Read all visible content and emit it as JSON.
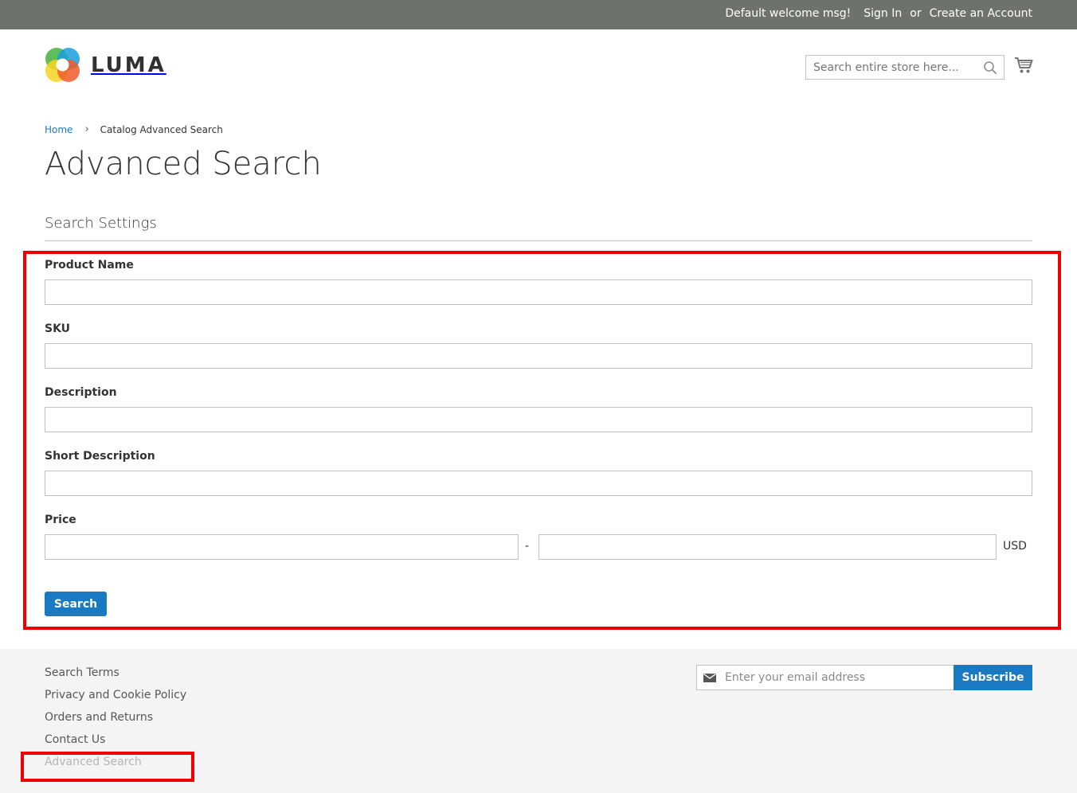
{
  "panel": {
    "welcome": "Default welcome msg!",
    "sign_in": "Sign In",
    "or": "or",
    "create_account": "Create an Account"
  },
  "header": {
    "logo_text": "LUMA",
    "search_placeholder": "Search entire store here...",
    "search_icon": "search-icon",
    "cart_icon": "cart-icon"
  },
  "breadcrumb": {
    "home": "Home",
    "current": "Catalog Advanced Search",
    "separator": "›"
  },
  "page": {
    "title": "Advanced Search",
    "legend": "Search Settings"
  },
  "form": {
    "product_name": {
      "label": "Product Name",
      "value": ""
    },
    "sku": {
      "label": "SKU",
      "value": ""
    },
    "description": {
      "label": "Description",
      "value": ""
    },
    "short_description": {
      "label": "Short Description",
      "value": ""
    },
    "price": {
      "label": "Price",
      "from": "",
      "to": "",
      "separator": "-",
      "currency": "USD"
    },
    "submit_label": "Search"
  },
  "footer": {
    "links": [
      {
        "label": "Search Terms"
      },
      {
        "label": "Privacy and Cookie Policy"
      },
      {
        "label": "Orders and Returns"
      },
      {
        "label": "Contact Us"
      },
      {
        "label": "Advanced Search"
      }
    ],
    "newsletter_placeholder": "Enter your email address",
    "subscribe_label": "Subscribe",
    "mail_icon": "envelope-icon"
  },
  "colors": {
    "panel_bg": "#6e716e",
    "primary": "#1979c3",
    "highlight": "#ee0000",
    "footer_bg": "#f4f4f4"
  }
}
